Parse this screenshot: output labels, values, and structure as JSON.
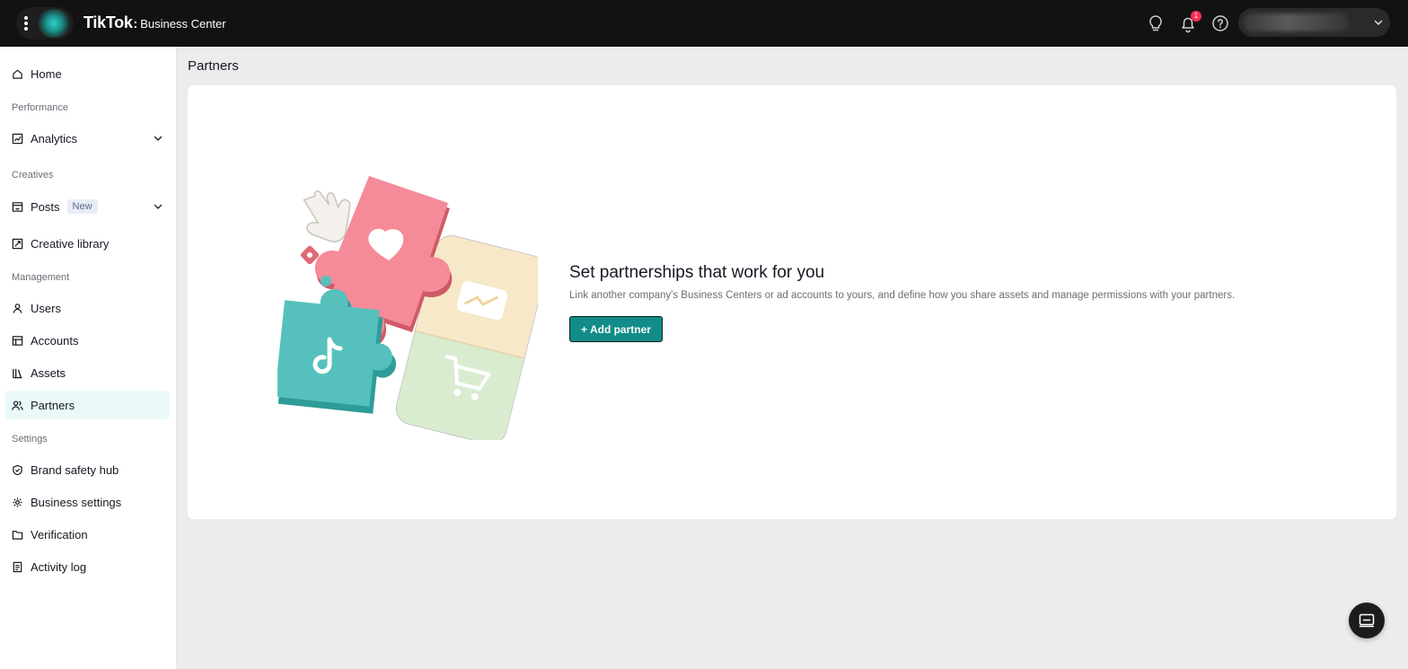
{
  "header": {
    "logo_text": "TikTok",
    "product_name": "Business Center",
    "notification_count": "1",
    "icons": [
      "menu-icon",
      "lightbulb-icon",
      "bell-icon",
      "help-icon",
      "chevron-down-icon"
    ]
  },
  "sidebar": {
    "home": "Home",
    "section_performance": "Performance",
    "analytics": "Analytics",
    "section_creatives": "Creatives",
    "posts": "Posts",
    "posts_badge": "New",
    "creative_library": "Creative library",
    "section_management": "Management",
    "users": "Users",
    "accounts": "Accounts",
    "assets": "Assets",
    "partners": "Partners",
    "section_settings": "Settings",
    "brand_safety_hub": "Brand safety hub",
    "business_settings": "Business settings",
    "verification": "Verification",
    "activity_log": "Activity log",
    "active_item": "Partners"
  },
  "main": {
    "page_title": "Partners",
    "hero_title": "Set partnerships that work for you",
    "hero_description": "Link another company's Business Centers or ad accounts to yours, and define how you share assets and manage permissions with your partners.",
    "add_button": "+ Add partner"
  },
  "colors": {
    "topbar": "#121212",
    "accent": "#128c89",
    "active_nav_bg": "#eafaf9",
    "badge": "#fe2c55"
  }
}
